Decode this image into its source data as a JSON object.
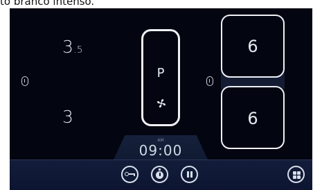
{
  "caption": "to branco intenso.",
  "zones": {
    "front_left": {
      "value": "3",
      "decimal": ".5"
    },
    "rear_left": {
      "value": "3"
    },
    "center": {
      "mode": "P"
    },
    "front_right": {
      "value": "6"
    },
    "rear_right": {
      "value": "6"
    }
  },
  "timer": {
    "am_label": "AM",
    "time": "09:00"
  },
  "icons": {
    "zone_lock_left": "lock-icon",
    "zone_lock_right": "lock-icon",
    "fan": "fan-icon",
    "key_lock": "key-icon",
    "stopwatch": "stopwatch-icon",
    "pause": "pause-icon",
    "menu": "grid-menu-icon"
  },
  "colors": {
    "panel_bg": "#030510",
    "bar_bg": "#131d3a",
    "text": "#dfe6f0",
    "outline": "#eef2f7"
  }
}
